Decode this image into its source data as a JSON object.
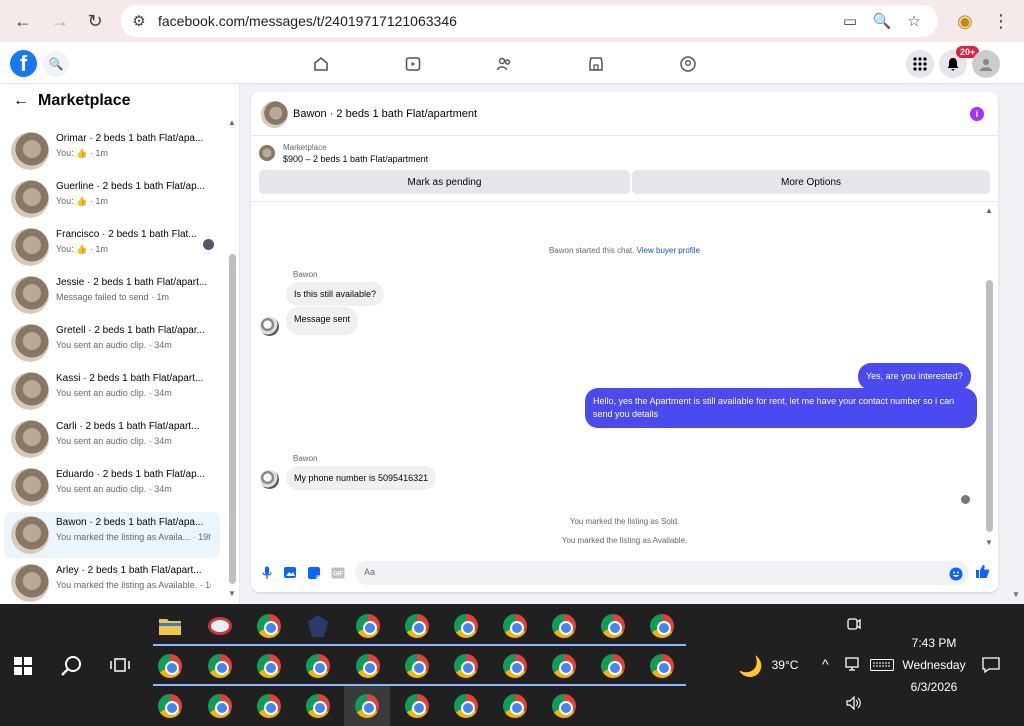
{
  "browser": {
    "url": "facebook.com/messages/t/24019717121063346"
  },
  "facebook": {
    "logo": "f",
    "notification_badge": "20+"
  },
  "sidebar": {
    "title": "Marketplace",
    "conversations": [
      {
        "name": "Orimar · 2 beds 1 bath Flat/apa...",
        "subtitle": "You: 👍 · 1m",
        "active": false
      },
      {
        "name": "Guerline · 2 beds 1 bath Flat/ap...",
        "subtitle": "You: 👍 · 1m",
        "active": false
      },
      {
        "name": "Francisco · 2 beds 1 bath Flat...",
        "subtitle": "You: 👍 · 1m",
        "active": false
      },
      {
        "name": "Jessie · 2 beds 1 bath Flat/apart...",
        "subtitle": "Message failed to send · 1m",
        "active": false
      },
      {
        "name": "Gretell · 2 beds 1 bath Flat/apar...",
        "subtitle": "You sent an audio clip. · 34m",
        "active": false
      },
      {
        "name": "Kassi · 2 beds 1 bath Flat/apart...",
        "subtitle": "You sent an audio clip. · 34m",
        "active": false
      },
      {
        "name": "Carli · 2 beds 1 bath Flat/apart...",
        "subtitle": "You sent an audio clip. · 34m",
        "active": false
      },
      {
        "name": "Eduardo · 2 beds 1 bath Flat/ap...",
        "subtitle": "You sent an audio clip. · 34m",
        "active": false
      },
      {
        "name": "Bawon · 2 beds 1 bath Flat/apa...",
        "subtitle": "You marked the listing as Availa... · 19h",
        "active": true
      },
      {
        "name": "Arley · 2 beds 1 bath Flat/apart...",
        "subtitle": "You marked the listing as Available. · 1d",
        "active": false
      }
    ]
  },
  "chat": {
    "title": "Bawon · 2 beds 1 bath Flat/apartment",
    "listing_category": "Marketplace",
    "listing_price": "$900 – 2 beds 1 bath Flat/apartment",
    "mark_pending_label": "Mark as pending",
    "more_options_label": "More Options",
    "started_text": "Bawon started this chat.",
    "view_profile_link": "View buyer profile",
    "messages": {
      "sender1": "Bawon",
      "in1": "Is this still available?",
      "in2": "Message sent",
      "out1": "Yes, are you interested?",
      "out2": "Hello, yes the Apartment is still available for rent, let me have your contact number so i can send you details",
      "sender2": "Bawon",
      "in3": "My phone number is 5095416321"
    },
    "system_sold": "You marked the listing as Sold.",
    "system_available": "You marked the listing as Available.",
    "compose_placeholder": "Aa"
  },
  "taskbar": {
    "time": "7:43 PM",
    "day": "Wednesday",
    "date": "6/3/2026",
    "weather": "39°C"
  }
}
